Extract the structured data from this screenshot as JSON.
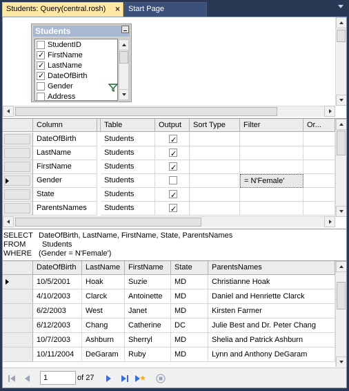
{
  "tabs": {
    "active": "Students: Query(central.rosh)",
    "inactive": "Start Page",
    "close_glyph": "×"
  },
  "diagram": {
    "table_title": "Students",
    "columns": [
      {
        "label": "StudentID",
        "checked": false
      },
      {
        "label": "FirstName",
        "checked": true
      },
      {
        "label": "LastName",
        "checked": true
      },
      {
        "label": "DateOfBirth",
        "checked": true
      },
      {
        "label": "Gender",
        "checked": false
      },
      {
        "label": "Address",
        "checked": false
      }
    ]
  },
  "criteria": {
    "headers": [
      "Column",
      "Table",
      "Output",
      "Sort Type",
      "Filter",
      "Or..."
    ],
    "rows": [
      {
        "column": "DateOfBirth",
        "table": "Students",
        "output": true,
        "filter": ""
      },
      {
        "column": "LastName",
        "table": "Students",
        "output": true,
        "filter": ""
      },
      {
        "column": "FirstName",
        "table": "Students",
        "output": true,
        "filter": ""
      },
      {
        "column": "Gender",
        "table": "Students",
        "output": false,
        "filter": "= N'Female'",
        "current": true
      },
      {
        "column": "State",
        "table": "Students",
        "output": true,
        "filter": ""
      },
      {
        "column": "ParentsNames",
        "table": "Students",
        "output": true,
        "filter": ""
      }
    ]
  },
  "sql": {
    "select_kw": "SELECT",
    "select_list": "DateOfBirth, LastName, FirstName, State, ParentsNames",
    "from_kw": "FROM",
    "from_table": "Students",
    "where_kw": "WHERE",
    "where_clause": "(Gender = N'Female')"
  },
  "results": {
    "headers": [
      "DateOfBirth",
      "LastName",
      "FirstName",
      "State",
      "ParentsNames"
    ],
    "rows": [
      [
        "10/5/2001",
        "Hoak",
        "Suzie",
        "MD",
        "Christianne Hoak"
      ],
      [
        "4/10/2003",
        "Clarck",
        "Antoinette",
        "MD",
        "Daniel and Henriette Clarck"
      ],
      [
        "6/2/2003",
        "West",
        "Janet",
        "MD",
        "Kirsten Farmer"
      ],
      [
        "6/12/2003",
        "Chang",
        "Catherine",
        "DC",
        "Julie Best and Dr. Peter Chang"
      ],
      [
        "10/7/2003",
        "Ashburn",
        "Sherryl",
        "MD",
        "Shelia and Patrick Ashburn"
      ],
      [
        "10/11/2004",
        "DeGaram",
        "Ruby",
        "MD",
        "Lynn and Anthony DeGaram"
      ]
    ]
  },
  "navigator": {
    "current_page": "1",
    "of_label": "of 27"
  },
  "colors": {
    "ide_background": "#293955",
    "active_tab": "#ffe8a6",
    "nav_blue": "#3b6dd1"
  }
}
